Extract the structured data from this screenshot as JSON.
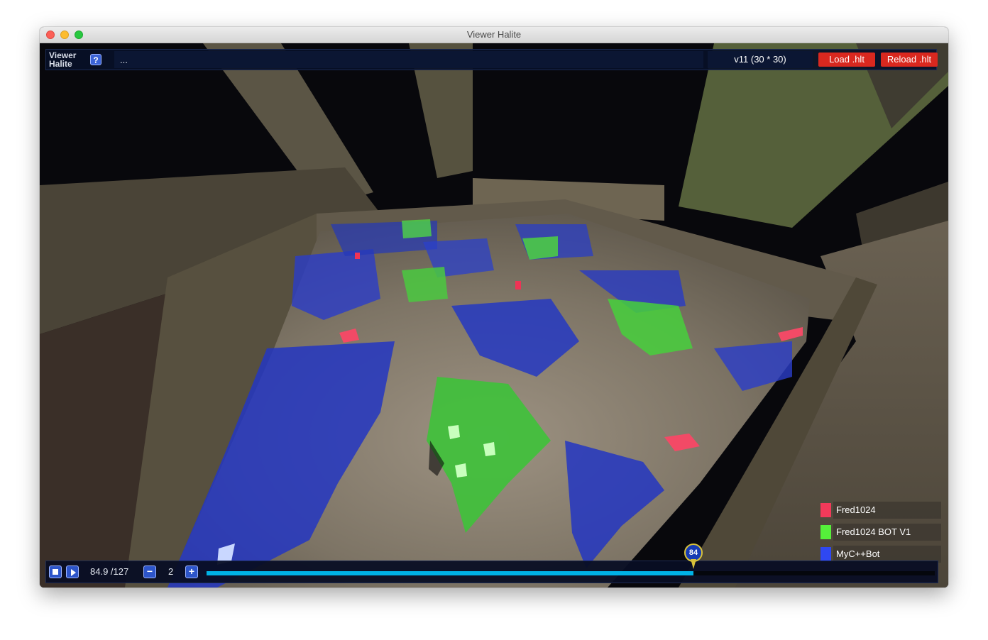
{
  "window": {
    "title": "Viewer Halite"
  },
  "topbar": {
    "logo_line1": "Viewer",
    "logo_line2": "Halite",
    "help_label": "?",
    "filename": "...",
    "version": "v11 (30 * 30)",
    "load_label": "Load .hlt",
    "reload_label": "Reload .hlt"
  },
  "legend": {
    "players": [
      {
        "name": "Fred1024",
        "color": "#f23a5a"
      },
      {
        "name": "Fred1024 BOT V1",
        "color": "#55f03a"
      },
      {
        "name": "MyC++Bot",
        "color": "#2f48f2"
      }
    ]
  },
  "playback": {
    "frame_display": "84.9 /127",
    "current_frame": 84.9,
    "total_frames": 127,
    "marker_label": "84",
    "speed": "2",
    "minus_label": "−",
    "plus_label": "+"
  },
  "icons": {
    "stop": "stop-icon",
    "play": "play-icon",
    "help": "question-icon"
  },
  "colors": {
    "accent_red": "#d9281f",
    "progress": "#00b2e6",
    "panel": "#081028"
  }
}
